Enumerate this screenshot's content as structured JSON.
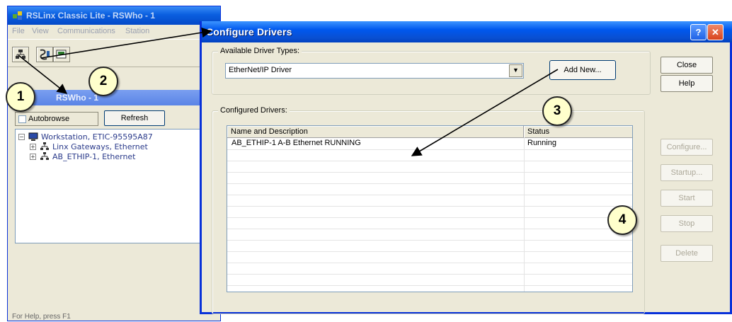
{
  "main_window": {
    "title": "RSLinx Classic Lite - RSWho - 1",
    "menu": [
      "File",
      "View",
      "Communications",
      "Station"
    ],
    "rswho_title": "RSWho - 1",
    "autobrowse_label": "Autobrowse",
    "refresh_label": "Refresh",
    "tree": [
      {
        "label": "Workstation, ETIC-95595A87",
        "icon": "workstation-icon",
        "expander": "−"
      },
      {
        "label": "Linx Gateways, Ethernet",
        "icon": "network-icon",
        "expander": "+"
      },
      {
        "label": "AB_ETHIP-1, Ethernet",
        "icon": "network-icon",
        "expander": "+"
      }
    ],
    "status_text": "For Help, press F1"
  },
  "dialog": {
    "title": "Configure Drivers",
    "help_label": "?",
    "close_label": "✕",
    "available_label": "Available Driver Types:",
    "selected_driver": "EtherNet/IP Driver",
    "add_new_label": "Add New...",
    "configured_label": "Configured Drivers:",
    "columns": {
      "name": "Name and Description",
      "status": "Status"
    },
    "drivers": [
      {
        "name": "AB_ETHIP-1  A-B Ethernet  RUNNING",
        "status": "Running"
      }
    ],
    "buttons": {
      "close": "Close",
      "help": "Help",
      "configure": "Configure...",
      "startup": "Startup...",
      "start": "Start",
      "stop": "Stop",
      "delete": "Delete"
    }
  },
  "callouts": [
    "1",
    "2",
    "3",
    "4"
  ],
  "colors": {
    "title_blue": "#0058ee",
    "callout_fill": "#ffffcc",
    "dialog_face": "#ece9d8"
  }
}
